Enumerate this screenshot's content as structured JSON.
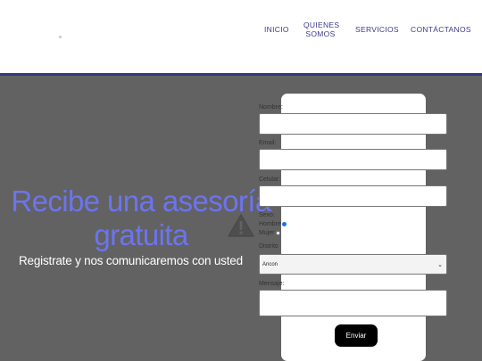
{
  "nav": {
    "inicio": "INICIO",
    "quienes": "QUIENES SOMOS",
    "servicios": "SERVICIOS",
    "contactanos": "CONTÁCTANOS"
  },
  "hero": {
    "title": "Recibe una asesoría gratuita",
    "subtitle": "Registrate y nos comunicaremos con usted"
  },
  "form": {
    "nombre_label": "Nombre:",
    "email_label": "Email:",
    "celular_label": "Celular:",
    "sexo_label": "Sexo:",
    "hombre_label": "Hombre",
    "mujer_label": "Mujer",
    "distrito_label": "Distrito",
    "distrito_value": "Ancon",
    "mensaje_label": "Mensaje:",
    "submit_label": "Enviar",
    "selected_sexo": "Hombre"
  },
  "colors": {
    "nav_text": "#3b3a8a",
    "header_line": "#34357e",
    "hero_bg": "#626262",
    "hero_title": "#6c74f0",
    "button_bg": "#000000"
  },
  "icons": [
    "warning-icon",
    "chevron-down-icon"
  ]
}
